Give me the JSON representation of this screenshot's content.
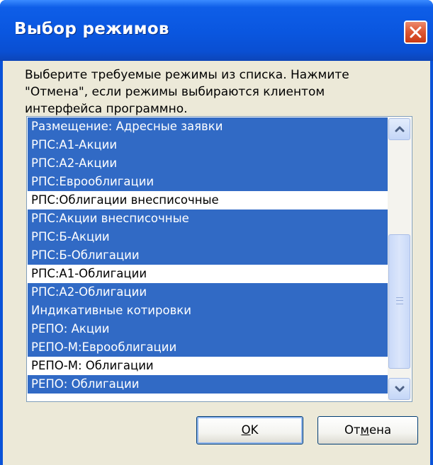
{
  "dialog": {
    "title": "Выбор режимов",
    "prompt_lines": [
      "Выберите требуемые режимы из списка. Нажмите",
      "\"Отмена\", если режимы выбираются клиентом",
      "интерфейса программно."
    ]
  },
  "list": {
    "items": [
      {
        "label": "Размещение: Адресные заявки",
        "selected": true
      },
      {
        "label": "РПС:А1-Акции",
        "selected": true
      },
      {
        "label": "РПС:А2-Акции",
        "selected": true
      },
      {
        "label": "РПС:Еврооблигации",
        "selected": true
      },
      {
        "label": "РПС:Облигации внесписочные",
        "selected": false
      },
      {
        "label": "РПС:Акции внесписочные",
        "selected": true
      },
      {
        "label": "РПС:Б-Акции",
        "selected": true
      },
      {
        "label": "РПС:Б-Облигации",
        "selected": true
      },
      {
        "label": "РПС:А1-Облигации",
        "selected": false
      },
      {
        "label": "РПС:А2-Облигации",
        "selected": true
      },
      {
        "label": "Индикативные котировки",
        "selected": true
      },
      {
        "label": "РЕПО: Акции",
        "selected": true
      },
      {
        "label": "РЕПО-М:Еврооблигации",
        "selected": true
      },
      {
        "label": "РЕПО-М: Облигации",
        "selected": false
      },
      {
        "label": "РЕПО: Облигации",
        "selected": true
      }
    ]
  },
  "buttons": {
    "ok_mnemonic": "O",
    "ok_rest": "K",
    "cancel_pre": "От",
    "cancel_mnemonic": "м",
    "cancel_post": "ена"
  },
  "colors": {
    "selection": "#316ac5",
    "titlebar": "#0a56df",
    "dialog_bg": "#ece9d8"
  },
  "icons": {
    "close": "close-x-icon",
    "scroll_up": "chevron-up-icon",
    "scroll_down": "chevron-down-icon"
  }
}
